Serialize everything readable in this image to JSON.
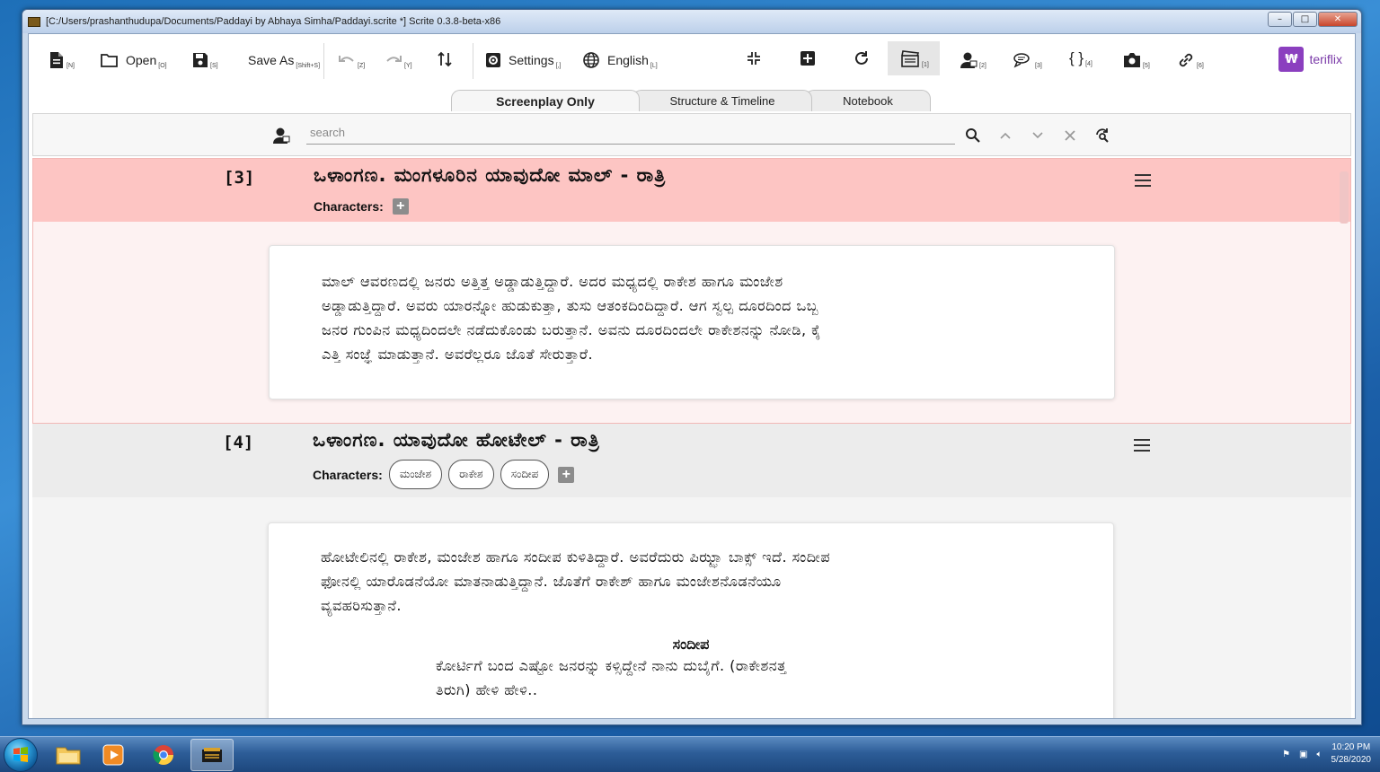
{
  "window": {
    "title": "[C:/Users/prashanthudupa/Documents/Paddayi by Abhaya Simha/Paddayi.scrite *] Scrite 0.3.8-beta-x86",
    "controls": {
      "minimize": "–",
      "maximize": "□",
      "close": "✕"
    }
  },
  "toolbar": {
    "new_shortcut": "[N]",
    "open_label": "Open",
    "open_shortcut": "[O]",
    "save_shortcut": "[S]",
    "save_as_label": "Save As",
    "save_as_shortcut": "[Shift+S]",
    "undo_shortcut": "[Z]",
    "redo_shortcut": "[Y]",
    "settings_label": "Settings",
    "settings_shortcut": "[,]",
    "language_label": "English",
    "language_shortcut": "[L]",
    "scene_shortcut": "[1]",
    "character_shortcut": "[2]",
    "dialogue_shortcut": "[3]",
    "parenthetical_shortcut": "[4]",
    "shot_shortcut": "[5]",
    "transition_shortcut": "[6]",
    "logo_text": "teriflix",
    "logo_mark": "₩"
  },
  "tabs": [
    {
      "label": "Screenplay Only",
      "active": true
    },
    {
      "label": "Structure & Timeline",
      "active": false
    },
    {
      "label": "Notebook",
      "active": false
    }
  ],
  "search": {
    "placeholder": "search"
  },
  "scenes": [
    {
      "number": "[3]",
      "heading": "ಒಳಾಂಗಣ. ಮಂಗಳೂರಿನ ಯಾವುದೋ ಮಾಲ್ - ರಾತ್ರಿ",
      "characters_label": "Characters:",
      "characters": [],
      "action_lines": [
        "ಮಾಲ್ ಆವರಣದಲ್ಲಿ ಜನರು ಅತ್ತಿತ್ತ ಅಡ್ಡಾಡುತ್ತಿದ್ದಾರೆ. ಅದರ ಮಧ್ಯದಲ್ಲಿ ರಾಕೇಶ ಹಾಗೂ ಮಂಜೇಶ",
        "ಅಡ್ಡಾಡುತ್ತಿದ್ದಾರೆ. ಅವರು ಯಾರನ್ನೋ ಹುಡುಕುತ್ತಾ, ತುಸು ಆತಂಕದಿಂದಿದ್ದಾರೆ. ಆಗ ಸ್ವಲ್ಪ ದೂರದಿಂದ ಒಬ್ಬ",
        "ಜನರ ಗುಂಪಿನ ಮಧ್ಯದಿಂದಲೇ ನಡೆದುಕೊಂಡು ಬರುತ್ತಾನೆ. ಅವನು ದೂರದಿಂದಲೇ ರಾಕೇಶನನ್ನು ನೋಡಿ, ಕೈ",
        "ಎತ್ತಿ ಸಂಜ್ಞೆ ಮಾಡುತ್ತಾನೆ. ಅವರೆಲ್ಲರೂ ಜೊತೆ ಸೇರುತ್ತಾರೆ."
      ]
    },
    {
      "number": "[4]",
      "heading": "ಒಳಾಂಗಣ. ಯಾವುದೋ ಹೋಟೇಲ್ - ರಾತ್ರಿ",
      "characters_label": "Characters:",
      "characters": [
        "ಮಂಜೇಶ",
        "ರಾಕೇಶ",
        "ಸಂದೀಪ"
      ],
      "action_lines": [
        "ಹೋಟೇಲಿನಲ್ಲಿ ರಾಕೇಶ, ಮಂಜೇಶ ಹಾಗೂ ಸಂದೀಪ ಕುಳಿತಿದ್ದಾರೆ. ಅವರೆದುರು ಪಿಝ್ಝಾ ಬಾಕ್ಸ್ ಇದೆ. ಸಂದೀಪ",
        "ಫೋನಲ್ಲಿ ಯಾರೊಡನೆಯೋ ಮಾತನಾಡುತ್ತಿದ್ದಾನೆ. ಜೊತೆಗೆ ರಾಕೇಶ್ ಹಾಗೂ ಮಂಜೇಶನೊಡನೆಯೂ",
        "ವ್ಯವಹರಿಸುತ್ತಾನೆ."
      ],
      "dialogue_character": "ಸಂದೀಪ",
      "dialogue_lines": [
        "ಕೋರ್ಟಿಗೆ ಬಂದ ಎಷ್ಟೋ ಜನರನ್ನು ಕಳ್ಸಿದ್ದೇನೆ ನಾನು ದುಬೈಗೆ. (ರಾಕೇಶನತ್ತ",
        "ತಿರುಗಿ) ಹೇಳಿ ಹೇಳಿ.."
      ]
    }
  ],
  "colors": {
    "current_scene_bg": "#fdc5c3",
    "current_scene_body": "#fdf2f2",
    "accent": "#8b3fbf"
  },
  "taskbar": {
    "time": "10:20 PM",
    "date": "5/28/2020",
    "apps": [
      "start-orb",
      "explorer",
      "media-player",
      "chrome",
      "scrite"
    ]
  }
}
